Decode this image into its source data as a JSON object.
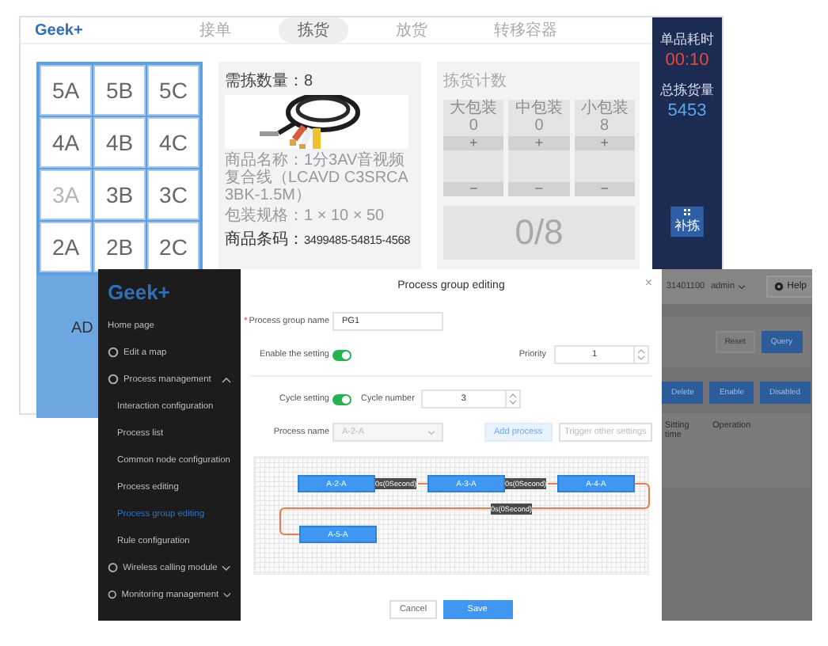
{
  "back_window": {
    "logo": "Geek+",
    "tabs": [
      {
        "label": "接单",
        "selected": false
      },
      {
        "label": "拣货",
        "selected": true
      },
      {
        "label": "放货",
        "selected": false
      },
      {
        "label": "转移容器",
        "selected": false
      }
    ],
    "slots": [
      {
        "label": "5A",
        "disabled": false
      },
      {
        "label": "5B",
        "disabled": false
      },
      {
        "label": "5C",
        "disabled": false
      },
      {
        "label": "4A",
        "disabled": false
      },
      {
        "label": "4B",
        "disabled": false
      },
      {
        "label": "4C",
        "disabled": false
      },
      {
        "label": "3A",
        "disabled": true
      },
      {
        "label": "3B",
        "disabled": false
      },
      {
        "label": "3C",
        "disabled": false
      },
      {
        "label": "2A",
        "disabled": false
      },
      {
        "label": "2B",
        "disabled": false
      },
      {
        "label": "2C",
        "disabled": false
      }
    ],
    "slot_panel_text": "AD",
    "item_card": {
      "quantity": "需拣数量：8",
      "name": "商品名称：1分3AV音视频复合线（LCAVD C3SRCA3BK-1.5M）",
      "spec_label": "包装规格：",
      "spec": "1 × 10 × 50",
      "barcode_label": "商品条码：",
      "barcode": "3499485-54815-4568"
    },
    "count_card": {
      "title": "拣货计数",
      "packs": [
        {
          "name": "大包装",
          "count": "0",
          "plus": "+",
          "minus": "−"
        },
        {
          "name": "中包装",
          "count": "0",
          "plus": "+",
          "minus": "−"
        },
        {
          "name": "小包装",
          "count": "8",
          "plus": "+",
          "minus": "−"
        }
      ],
      "progress": "0/8"
    },
    "stats": [
      {
        "label": "单品耗时",
        "value": "00:10",
        "kind": "time"
      },
      {
        "label": "总拣货量",
        "value": "5453",
        "kind": "total"
      }
    ],
    "side_button": "补拣"
  },
  "front_window": {
    "sidebar": {
      "logo": "Geek+",
      "items": [
        {
          "label": "Home page",
          "kind": "text",
          "selected": false
        },
        {
          "label": "Edit a map",
          "kind": "link",
          "selected": false
        },
        {
          "label": "Process management",
          "kind": "group",
          "expanded": true,
          "children": [
            {
              "label": "Interaction configuration",
              "selected": false
            },
            {
              "label": "Process list",
              "selected": false
            },
            {
              "label": "Common node configuration",
              "selected": false
            },
            {
              "label": "Process editing",
              "selected": false
            },
            {
              "label": "Process group editing",
              "selected": true
            },
            {
              "label": "Rule configuration",
              "selected": false
            }
          ]
        },
        {
          "label": "Wireless calling module",
          "kind": "group",
          "expanded": false
        },
        {
          "label": "Monitoring management",
          "kind": "group",
          "expanded": false
        }
      ]
    },
    "header": {
      "account": "31401100",
      "user": "admin",
      "help": "Help"
    },
    "query_buttons": [
      "Reset",
      "Query"
    ],
    "actions": [
      "Delete",
      "Enable",
      "Disabled"
    ],
    "table_columns": [
      "Sitting time",
      "Operation"
    ],
    "modal": {
      "title": "Process group editing",
      "close": "×",
      "group_name": {
        "required_mark": "*",
        "label": "Process group name",
        "value": "PG1"
      },
      "enable": {
        "label": "Enable the setting",
        "on": true
      },
      "priority": {
        "label": "Priority",
        "value": "1"
      },
      "cycle": {
        "label": "Cycle setting",
        "on": true
      },
      "cycle_number": {
        "label": "Cycle number",
        "value": "3"
      },
      "process_name": {
        "label": "Process name",
        "value": "A-2-A",
        "disabled": true
      },
      "add_process": "Add process",
      "trigger": "Trigger other settings",
      "flow": {
        "nodes": [
          "A-2-A",
          "A-3-A",
          "A-4-A",
          "A-5-A"
        ],
        "links": [
          "0s(0Second)",
          "0s(0Second)",
          "0s(0Second)"
        ]
      },
      "buttons": [
        {
          "label": "Cancel",
          "kind": "secondary"
        },
        {
          "label": "Save",
          "kind": "primary"
        }
      ]
    }
  }
}
